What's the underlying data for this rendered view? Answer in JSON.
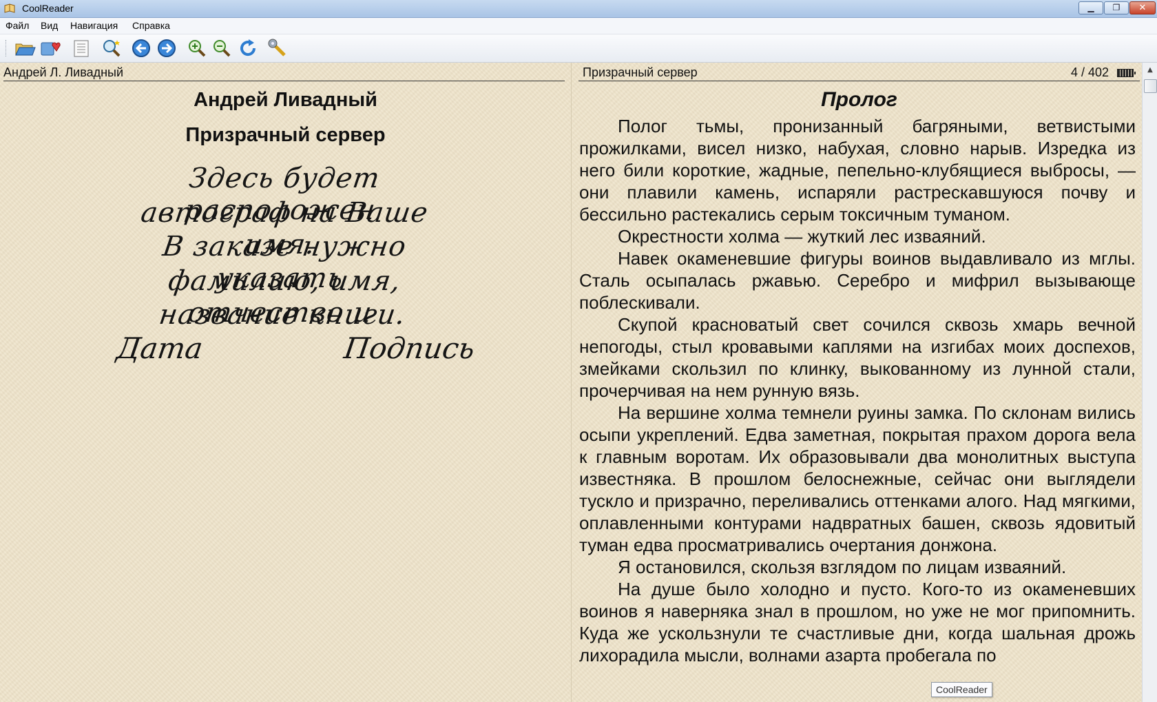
{
  "window": {
    "title": "CoolReader",
    "controls": {
      "minimize": "▁",
      "maximize": "❐",
      "close": "✕"
    }
  },
  "menu": [
    "Файл",
    "Вид",
    "Навигация",
    "Справка"
  ],
  "toolbar": {
    "buttons": [
      "open-file-icon",
      "recent-books-icon",
      "table-of-contents-icon",
      "search-icon",
      "back-arrow-icon",
      "forward-arrow-icon",
      "zoom-in-icon",
      "zoom-out-icon",
      "rotate-icon",
      "settings-wrench-icon"
    ]
  },
  "left_page": {
    "header": "Андрей Л. Ливадный",
    "author": "Андрей Ливадный",
    "title": "Призрачный сервер",
    "autograph_lines": [
      "Здесь будет расположен",
      "автограф на Ваше имя.",
      "В заказе нужно указать",
      "фамилию, имя, отчество и",
      "название книги."
    ],
    "date_label": "Дата",
    "signature_label": "Подпись"
  },
  "right_page": {
    "header": "Призрачный сервер",
    "page_number": "4 / 402",
    "chapter": "Пролог",
    "paragraphs": [
      "Полог тьмы, пронизанный багряными, ветвистыми прожилками, висел низко, набухая, словно нарыв. Изредка из него били короткие, жадные, пепельно-клубящиеся выбросы, — они плавили камень, испаряли растрескавшуюся почву и бессильно растекались серым токсичным туманом.",
      "Окрестности холма — жуткий лес изваяний.",
      "Навек окаменевшие фигуры воинов выдавливало из мглы. Сталь осыпалась ржавью. Серебро и мифрил вызывающе поблескивали.",
      "Скупой красноватый свет сочился сквозь хмарь вечной непогоды, стыл кровавыми каплями на изгибах моих доспехов, змейками скользил по клинку, выкованному из лунной стали, прочерчивая на нем рунную вязь.",
      "На вершине холма темнели руины замка. По склонам вились осыпи укреплений. Едва заметная, покрытая прахом дорога вела к главным воротам. Их образовывали два монолитных выступа известняка. В прошлом белоснежные, сейчас они выглядели тускло и призрачно, переливались оттенками алого. Над мягкими, оплавленными контурами надвратных башен, сквозь ядовитый туман едва просматривались очертания донжона.",
      "Я остановился, скользя взглядом по лицам изваяний.",
      "На душе было холодно и пусто. Кого-то из окаменевших воинов я наверняка знал в прошлом, но уже не мог припомнить. Куда же ускользнули те счастливые дни, когда шальная дрожь лихорадила мысли, волнами азарта пробегала по"
    ]
  },
  "scrollbar": {
    "up_arrow": "▲"
  },
  "tooltip": "CoolReader",
  "colors": {
    "page_background": "#efe5cd",
    "text": "#111111",
    "titlebar": "#b8d0ea"
  }
}
